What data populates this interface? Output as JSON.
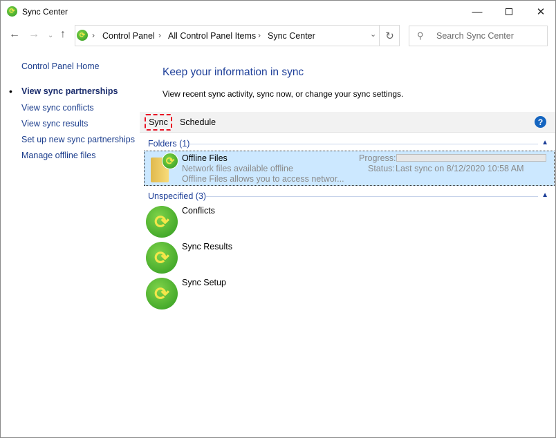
{
  "window": {
    "title": "Sync Center"
  },
  "address": {
    "crumbs": [
      "Control Panel",
      "All Control Panel Items",
      "Sync Center"
    ]
  },
  "search": {
    "placeholder": "Search Sync Center"
  },
  "sidebar": {
    "home": "Control Panel Home",
    "items": [
      {
        "label": "View sync partnerships",
        "active": true
      },
      {
        "label": "View sync conflicts"
      },
      {
        "label": "View sync results"
      },
      {
        "label": "Set up new sync partnerships"
      },
      {
        "label": "Manage offline files"
      }
    ]
  },
  "main": {
    "heading": "Keep your information in sync",
    "subtitle": "View recent sync activity, sync now, or change your sync settings."
  },
  "toolbar": {
    "sync": "Sync",
    "schedule": "Schedule"
  },
  "groups": {
    "folders": {
      "label": "Folders (1)",
      "item": {
        "name": "Offline Files",
        "line1": "Network files available offline",
        "line2": "Offline Files allows you to access networ...",
        "progress_label": "Progress:",
        "progress": 0,
        "status_label": "Status:",
        "status": "Last sync on 8/12/2020 10:58 AM"
      }
    },
    "unspecified": {
      "label": "Unspecified (3)",
      "items": [
        "Conflicts",
        "Sync Results",
        "Sync Setup"
      ]
    }
  },
  "colors": {
    "link": "#1a3c8c",
    "selection": "#cce8ff",
    "highlight": "#e81123"
  }
}
